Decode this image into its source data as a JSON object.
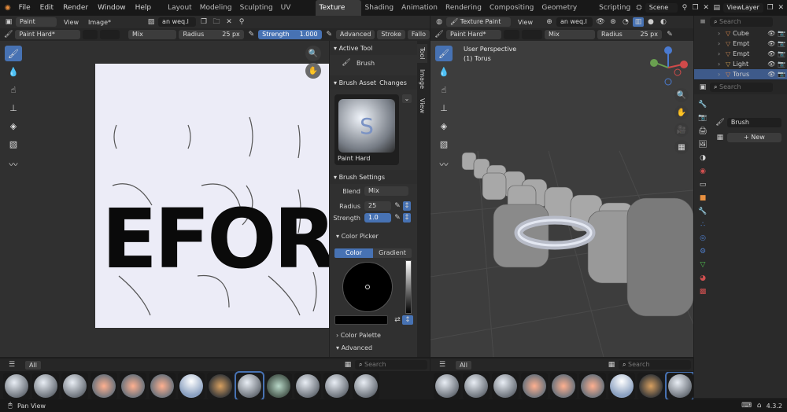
{
  "menus": [
    "File",
    "Edit",
    "Render",
    "Window",
    "Help"
  ],
  "workspaces": [
    "Layout",
    "Modeling",
    "Sculpting",
    "UV Editing",
    "Texture Paint",
    "Shading",
    "Animation",
    "Rendering",
    "Compositing",
    "Geometry Nodes",
    "Scripting"
  ],
  "active_workspace": "Texture Paint",
  "scene": "Scene",
  "view_layer": "ViewLayer",
  "left": {
    "mode": "Paint",
    "view_menu": "View",
    "image_menu": "Image*",
    "image_name": "an weq.l",
    "brush": "Paint Hard*",
    "blend": "Mix",
    "radius_label": "Radius",
    "radius_value": "25 px",
    "strength_label": "Strength",
    "strength_value": "1.000",
    "advanced": "Advanced",
    "stroke": "Stroke",
    "falloff": "Fallo",
    "canvas_text": "EFORT"
  },
  "npanel": {
    "tabs": [
      "Tool",
      "Image",
      "View"
    ],
    "active_tool_header": "Active Tool",
    "active_tool": "Brush",
    "brush_asset_header": "Brush Asset",
    "brush_asset_overlay": "Changes",
    "brush_name": "Paint Hard",
    "brush_settings_header": "Brush Settings",
    "blend_label": "Blend",
    "blend_value": "Mix",
    "radius_label": "Radius",
    "radius_value": "25",
    "strength_label": "Strength",
    "strength_value": "1.0",
    "color_picker_header": "Color Picker",
    "color_tab": "Color",
    "gradient_tab": "Gradient",
    "color_palette_header": "Color Palette",
    "advanced_header": "Advanced"
  },
  "right_view": {
    "mode": "Texture Paint",
    "view_menu": "View",
    "image_name": "an weq.l",
    "brush": "Paint Hard*",
    "blend": "Mix",
    "radius_label": "Radius",
    "radius_value": "25 px",
    "perspective": "User Perspective",
    "object": "(1) Torus"
  },
  "asset_bar_left": {
    "filter": "All",
    "search": "Search"
  },
  "asset_bar_right": {
    "filter": "All",
    "search": "Search"
  },
  "outliner": {
    "search": "Search",
    "items": [
      {
        "name": "Cube",
        "color": "#e0894a",
        "selected": false
      },
      {
        "name": "Empt",
        "color": "#c08050",
        "selected": false
      },
      {
        "name": "Empt",
        "color": "#c08050",
        "selected": false
      },
      {
        "name": "Light",
        "color": "#d0a050",
        "selected": false
      },
      {
        "name": "Torus",
        "color": "#e0894a",
        "selected": true
      }
    ]
  },
  "properties": {
    "search": "Search",
    "brush_label": "Brush",
    "new_button": "New"
  },
  "status": {
    "left": "Pan View",
    "version": "4.3.2"
  },
  "colors": {
    "accent": "#4772b3",
    "header": "#2b2b2b",
    "panel": "#303030",
    "canvas": "#ececf7"
  }
}
